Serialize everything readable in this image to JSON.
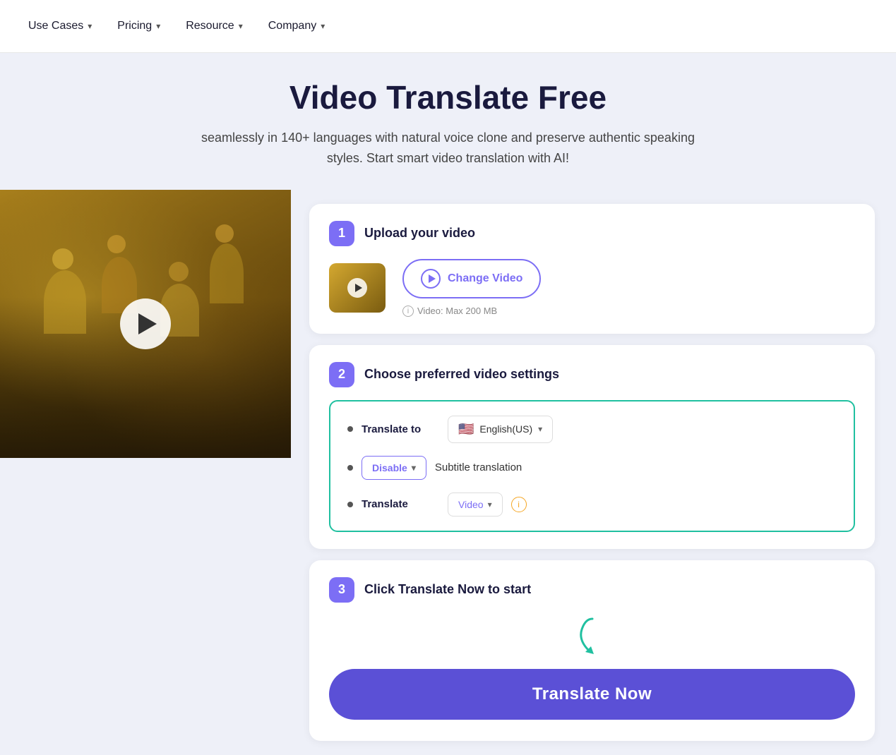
{
  "nav": {
    "items": [
      {
        "label": "Use Cases",
        "has_dropdown": true
      },
      {
        "label": "Pricing",
        "has_dropdown": true
      },
      {
        "label": "Resource",
        "has_dropdown": true
      },
      {
        "label": "Company",
        "has_dropdown": true
      }
    ]
  },
  "hero": {
    "title": "Video Translate Free",
    "subtitle": "seamlessly in 140+ languages with natural voice clone and preserve authentic speaking styles. Start smart video translation with AI!"
  },
  "step1": {
    "badge": "1",
    "title": "Upload your video",
    "change_video_label": "Change Video",
    "max_size_label": "Video: Max 200 MB"
  },
  "step2": {
    "badge": "2",
    "title": "Choose preferred video settings",
    "translate_to_label": "Translate to",
    "language_value": "English(US)",
    "language_flag": "🇺🇸",
    "subtitle_label": "Subtitle translation",
    "subtitle_value": "Disable",
    "translate_label": "Translate",
    "translate_type_value": "Video"
  },
  "step3": {
    "badge": "3",
    "title": "Click Translate Now to start",
    "button_label": "Translate Now"
  }
}
